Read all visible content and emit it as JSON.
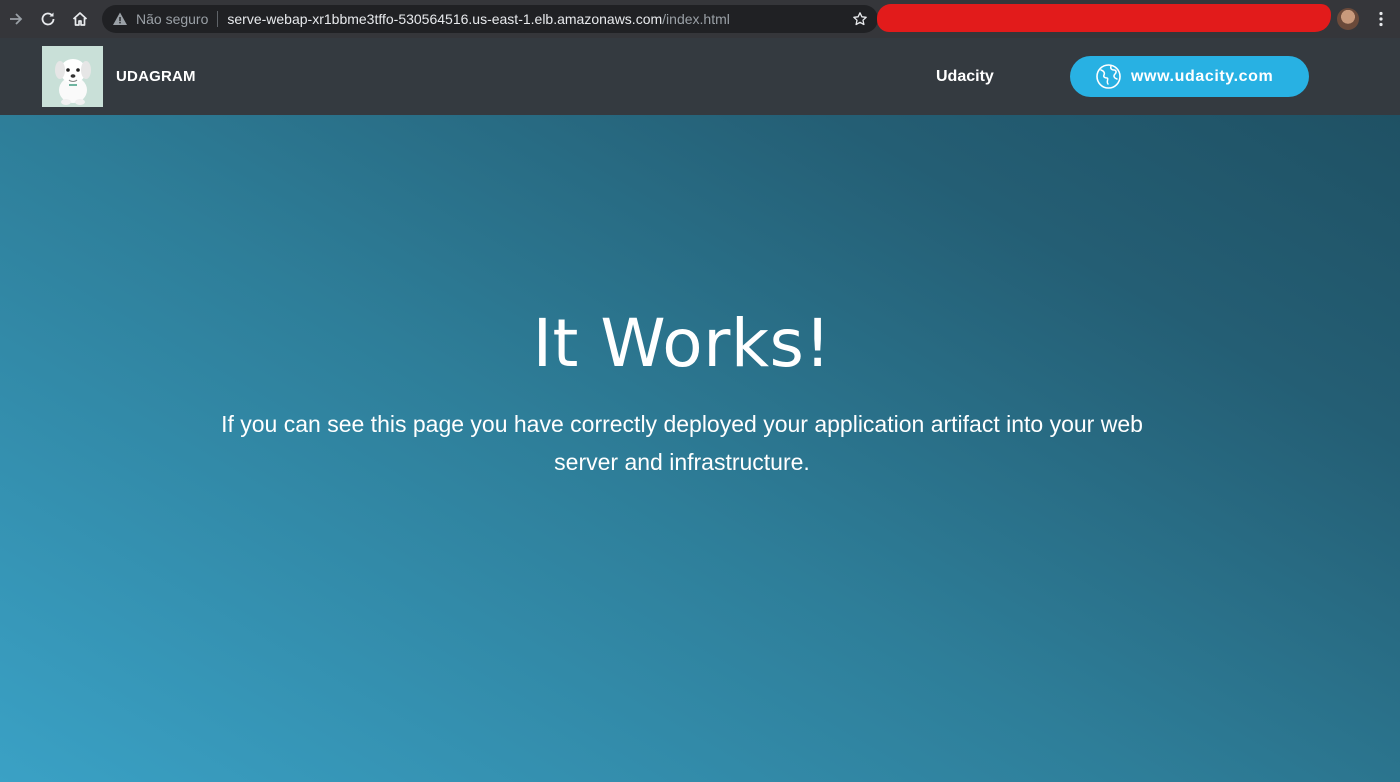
{
  "browser": {
    "security_label": "Não seguro",
    "url_host": "serve-webap-xr1bbme3tffo-530564516.us-east-1.elb.amazonaws.com",
    "url_path": "/index.html"
  },
  "site": {
    "brand": "UDAGRAM",
    "nav_link": "Udacity",
    "cta_label": "www.udacity.com",
    "cta_color": "#28b1e3",
    "nav_bg": "#343a40"
  },
  "hero": {
    "title": "It Works!",
    "text": "If you can see this page you have correctly deployed your application artifact into your web server and infrastructure."
  }
}
